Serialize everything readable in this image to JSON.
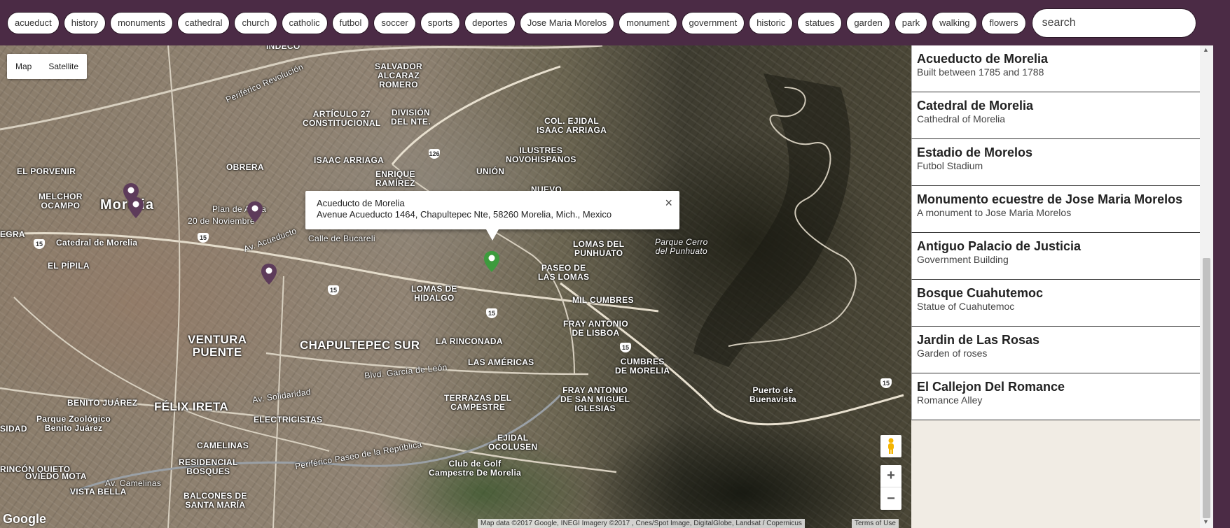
{
  "tags": [
    "acueduct",
    "history",
    "monuments",
    "cathedral",
    "church",
    "catholic",
    "futbol",
    "soccer",
    "sports",
    "deportes",
    "Jose Maria Morelos",
    "monument",
    "government",
    "historic",
    "statues",
    "garden",
    "park",
    "walking",
    "flowers"
  ],
  "search": {
    "placeholder": "search"
  },
  "map": {
    "map_type_options": [
      "Map",
      "Satellite"
    ],
    "labels": [
      "INDECO",
      "SALVADOR\nALCARAZ\nROMERO",
      "ARTÍCULO 27\nCONSTITUCIONAL",
      "DIVISIÓN\nDEL NTE.",
      "COL. EJIDAL\nISAAC ARRIAGA",
      "ILUSTRES\nNOVOHISPANOS",
      "UNIÓN",
      "ISAAC ARRIAGA",
      "ENRIQUE\nRAMÍREZ",
      "OBRERA",
      "EL PORVENIR",
      "MELCHOR\nOCAMPO",
      "Morelia",
      "Catedral de Morelia",
      "EL PÍPILA",
      "LOMAS DEL\nPUNHUATO",
      "Parque Cerro\ndel Punhuato",
      "PASEO DE\nLAS LOMAS",
      "LOMAS DE\nHIDALGO",
      "MIL CUMBRES",
      "FRAY ANTONIO\nDE LISBOA",
      "VENTURA\nPUENTE",
      "CHAPULTEPEC SUR",
      "LA RINCONADA",
      "LAS AMÉRICAS",
      "CUMBRES\nDE MORELIA",
      "BENITO JUÁREZ",
      "FÉLIX IRETA",
      "ELECTRICISTAS",
      "TERRAZAS DEL\nCAMPESTRE",
      "FRAY ANTONIO\nDE SAN MIGUEL\nIGLESIAS",
      "Puerto de\nBuenavista",
      "Parque Zoológico\nBenito Juárez",
      "CAMELINAS",
      "RESIDENCIAL\nBOSQUES",
      "EJIDAL\nOCOLUSEN",
      "Club de Golf\nCampestre De Morelia",
      "RINCÓN QUIETO",
      "OVIEDO MOTA",
      "VISTA BELLA",
      "BALCONES DE\nSANTA MARÍA",
      "Plan de Ayala",
      "20 de Noviembre",
      "NUEVO",
      "EGRA",
      "SIDAD"
    ],
    "roads": [
      "Periférico Revolución",
      "Calle de Bucareli",
      "Av. Camelinas",
      "Av. Solidaridad",
      "Av. Acueducto",
      "Blvd. García de León",
      "Periférico Paseo de la República"
    ],
    "highway_shields": [
      "15",
      "15",
      "15",
      "15",
      "15",
      "15",
      "126"
    ],
    "colors": {
      "selected_marker": "#3d9b3d",
      "marker": "#5d3b5a"
    },
    "infowindow": {
      "title": "Acueducto de Morelia",
      "address": "Avenue Acueducto 1464, Chapultepec Nte, 58260 Morelia, Mich., Mexico",
      "close": "×"
    },
    "zoom_in": "+",
    "zoom_out": "−",
    "logo": "Google",
    "attribution": "Map data ©2017 Google, INEGI Imagery ©2017 , Cnes/Spot Image, DigitalGlobe, Landsat / Copernicus",
    "terms": "Terms of Use"
  },
  "places": [
    {
      "name": "Acueducto de Morelia",
      "desc": "Built between 1785 and 1788"
    },
    {
      "name": "Catedral de Morelia",
      "desc": "Cathedral of Morelia"
    },
    {
      "name": "Estadio de Morelos",
      "desc": "Futbol Stadium"
    },
    {
      "name": "Monumento ecuestre de Jose Maria Morelos",
      "desc": "A monument to Jose Maria Morelos"
    },
    {
      "name": "Antiguo Palacio de Justicia",
      "desc": "Government Building"
    },
    {
      "name": "Bosque Cuahutemoc",
      "desc": "Statue of Cuahutemoc"
    },
    {
      "name": "Jardin de Las Rosas",
      "desc": "Garden of roses"
    },
    {
      "name": "El Callejon Del Romance",
      "desc": "Romance Alley"
    }
  ],
  "scrollbar": {
    "up": "▲",
    "down": "▼"
  }
}
